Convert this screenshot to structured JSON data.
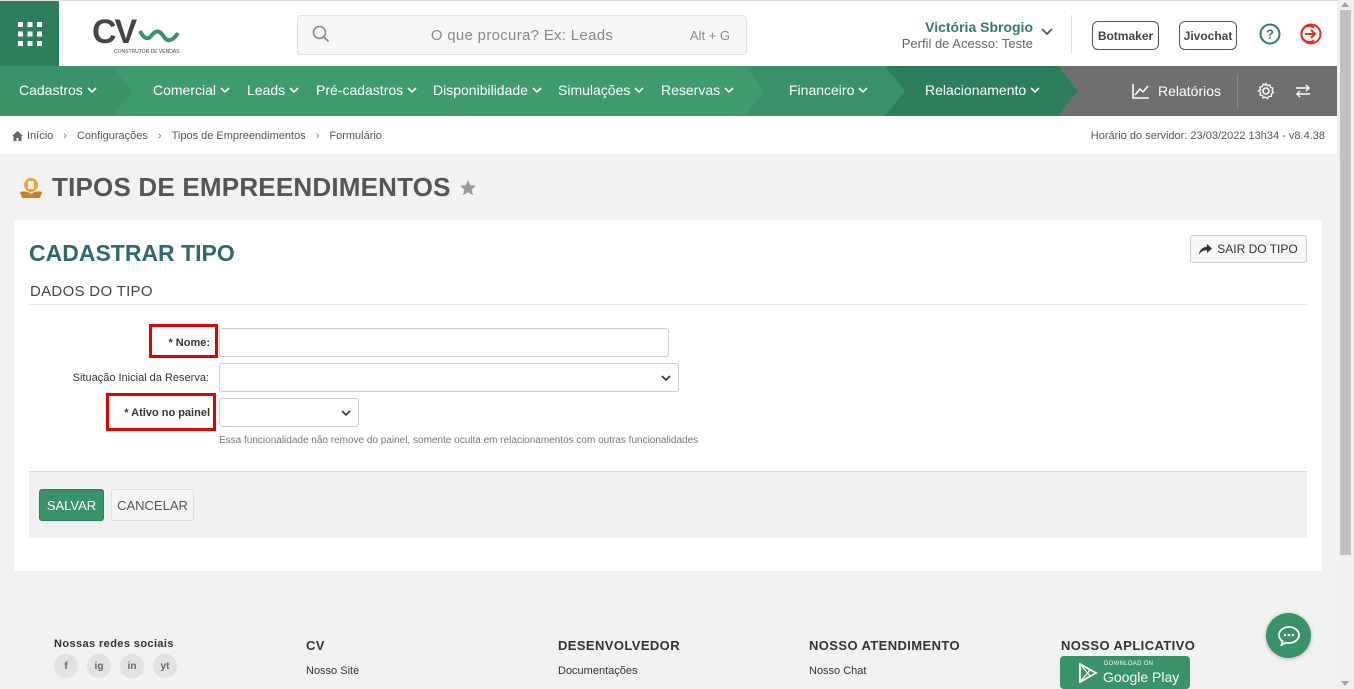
{
  "header": {
    "search_placeholder": "O que procura? Ex: Leads",
    "search_shortcut": "Alt + G",
    "user_name": "Victória Sbrogio",
    "user_profile": "Perfil de Acesso: Teste",
    "botmaker_label": "Botmaker",
    "jivochat_label": "Jivochat",
    "logo": {
      "mark": "CV",
      "tagline": "CONSTRUTOR DE VENDAS"
    }
  },
  "nav": {
    "items": [
      "Cadastros",
      "Comercial",
      "Leads",
      "Pré-cadastros",
      "Disponibilidade",
      "Simulações",
      "Reservas",
      "Financeiro",
      "Relacionamento"
    ],
    "reports_label": "Relatórios"
  },
  "breadcrumb": {
    "items": [
      "Início",
      "Configurações",
      "Tipos de Empreendimentos",
      "Formulário"
    ],
    "server_time": "Horário do servidor: 23/03/2022 13h34 - v8.4.38"
  },
  "page": {
    "title": "TIPOS DE EMPREENDIMENTOS",
    "card_title": "CADASTRAR TIPO",
    "exit_label": "SAIR DO TIPO",
    "section_title": "DADOS DO TIPO"
  },
  "form": {
    "nome_label": "* Nome:",
    "nome_value": "",
    "situacao_label": "Situação Inicial da Reserva:",
    "situacao_value": "",
    "ativo_label": "* Ativo no painel",
    "ativo_value": "",
    "ativo_help": "Essa funcionalidade não remove do painel, somente oculta em relacionamentos com outras funcionalidades",
    "save_label": "SALVAR",
    "cancel_label": "CANCELAR"
  },
  "footer": {
    "social_title": "Nossas redes sociais",
    "col_cv": "CV",
    "col_cv_link": "Nosso Site",
    "col_dev": "DESENVOLVEDOR",
    "col_dev_link": "Documentações",
    "col_support": "NOSSO ATENDIMENTO",
    "col_support_link": "Nosso Chat",
    "col_app": "NOSSO APLICATIVO",
    "gplay_small": "DOWNLOAD ON",
    "gplay_big": "Google Play",
    "social_icons": [
      "f",
      "ig",
      "in",
      "yt"
    ]
  },
  "colors": {
    "brand_green": "#3a9268",
    "brand_dark_green": "#2e7d5b",
    "title_teal": "#2d6b6b",
    "highlight_red": "#e00000"
  }
}
